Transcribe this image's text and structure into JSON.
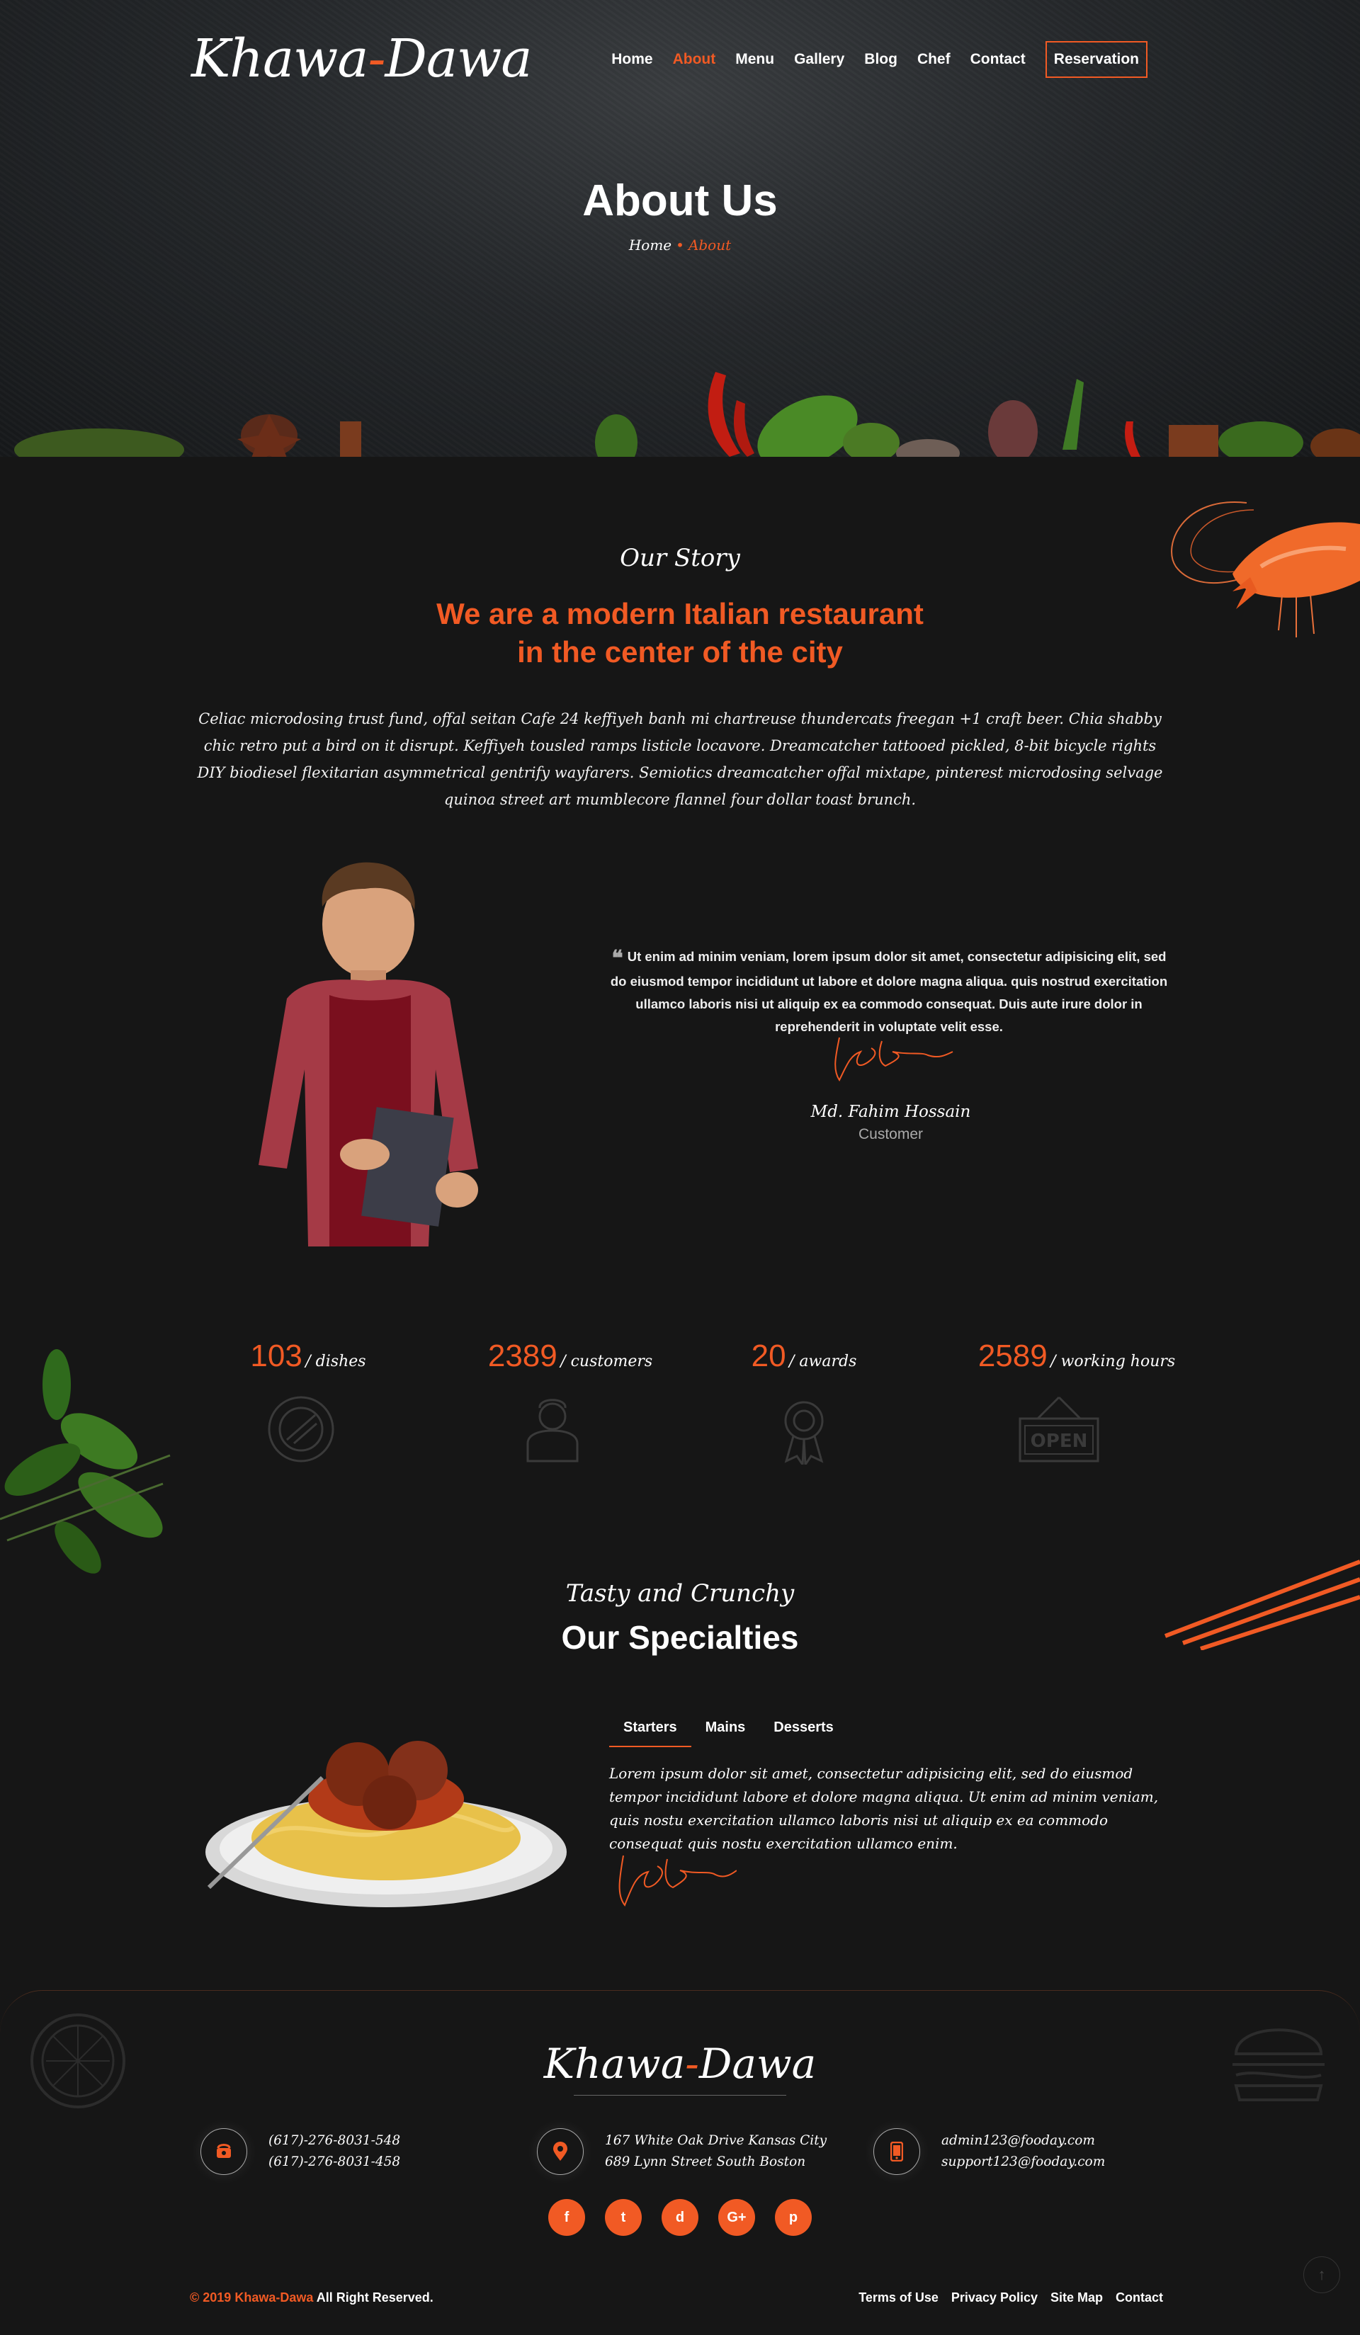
{
  "header": {
    "logo": {
      "part1": "Khawa",
      "dash": "-",
      "part2": "Dawa"
    },
    "nav": [
      "Home",
      "About",
      "Menu",
      "Gallery",
      "Blog",
      "Chef",
      "Contact"
    ],
    "reservation": "Reservation",
    "title": "About Us",
    "breadcrumb": {
      "home": "Home",
      "sep": "•",
      "current": "About"
    }
  },
  "story": {
    "kicker": "Our Story",
    "heading_line1": "We are a modern Italian restaurant",
    "heading_line2": "in the center of the city",
    "text": "Celiac microdosing trust fund, offal seitan Cafe 24 keffiyeh banh mi chartreuse thundercats freegan +1 craft beer. Chia shabby chic retro put a bird on it disrupt. Keffiyeh tousled ramps listicle locavore. Dreamcatcher tattooed pickled, 8-bit bicycle rights DIY biodiesel flexitarian asymmetrical gentrify wayfarers. Semiotics dreamcatcher offal mixtape, pinterest microdosing selvage quinoa street art mumblecore flannel four dollar toast brunch."
  },
  "testimonial": {
    "quote_mark": "❝",
    "quote": "Ut enim ad minim veniam, lorem ipsum dolor sit amet, consectetur adipisicing elit, sed do eiusmod tempor incididunt ut labore et dolore magna aliqua. quis nostrud exercitation ullamco laboris nisi ut aliquip ex ea commodo consequat. Duis aute irure dolor in reprehenderit in voluptate velit esse.",
    "name": "Md. Fahim Hossain",
    "role": "Customer"
  },
  "stats": [
    {
      "num": "103",
      "label": "/ dishes",
      "icon": "dish-icon"
    },
    {
      "num": "2389",
      "label": "/ customers",
      "icon": "chef-icon"
    },
    {
      "num": "20",
      "label": "/ awards",
      "icon": "award-icon"
    },
    {
      "num": "2589",
      "label": "/ working hours",
      "icon": "open-sign-icon"
    }
  ],
  "specialties": {
    "kicker": "Tasty and Crunchy",
    "heading": "Our Specialties",
    "tabs": [
      "Starters",
      "Mains",
      "Desserts"
    ],
    "active_tab": "Starters",
    "text": "Lorem ipsum dolor sit amet, consectetur adipisicing elit, sed do eiusmod tempor incididunt labore et dolore magna aliqua. Ut enim ad minim veniam, quis nostu exercitation ullamco laboris nisi ut aliquip ex ea commodo consequat quis nostu exercitation ullamco enim."
  },
  "footer": {
    "logo": {
      "part1": "Khawa",
      "dash": "-",
      "part2": "Dawa"
    },
    "phones": [
      "(617)-276-8031-548",
      "(617)-276-8031-458"
    ],
    "address": [
      "167 White Oak Drive Kansas City",
      "689 Lynn Street South Boston"
    ],
    "emails": [
      "admin123@fooday.com",
      "support123@fooday.com"
    ],
    "socials": [
      "f",
      "t",
      "d",
      "G+",
      "p"
    ],
    "copyright_pre": "© 2019",
    "copyright_brand": "Khawa-Dawa",
    "copyright_post": "All Right Reserved.",
    "links": [
      "Terms of Use",
      "Privacy Policy",
      "Site Map",
      "Contact"
    ],
    "up_arrow": "↑"
  },
  "colors": {
    "accent": "#f15a24",
    "background": "#161616"
  }
}
